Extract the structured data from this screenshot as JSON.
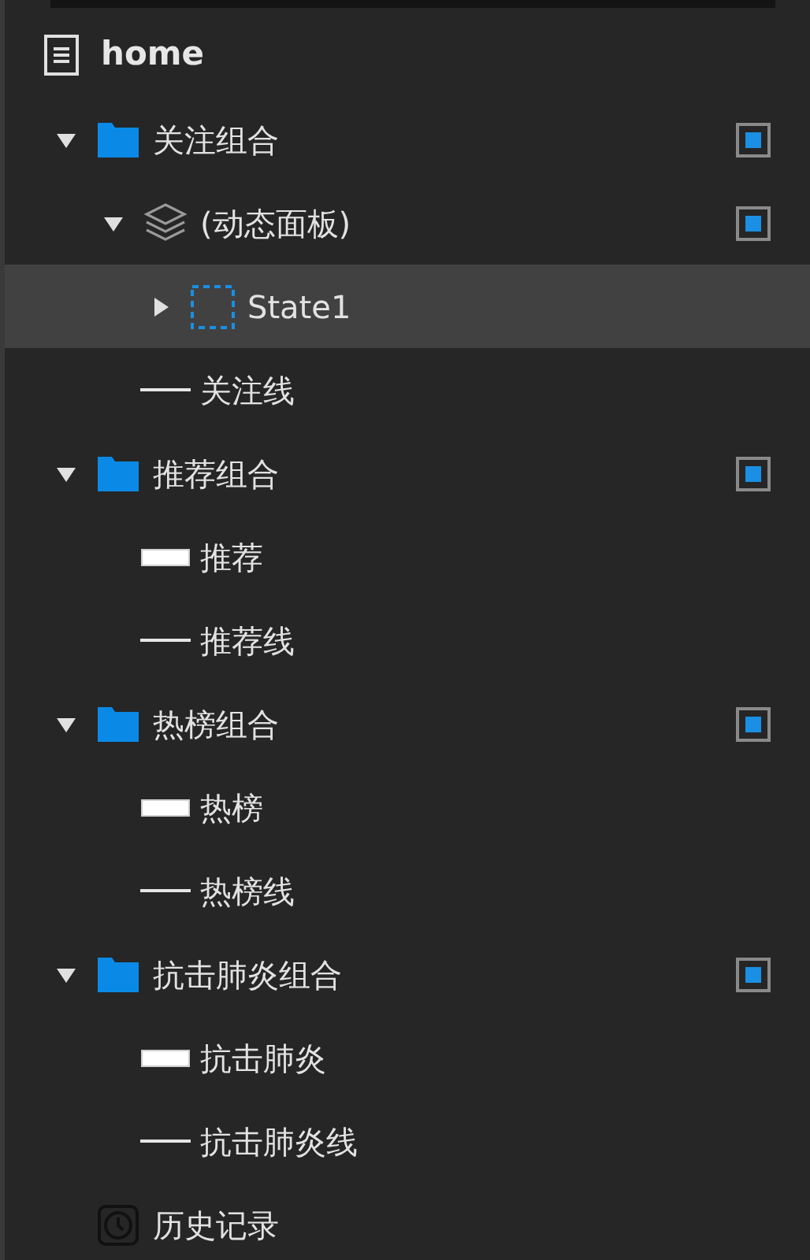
{
  "page": {
    "title": "home"
  },
  "layers": [
    {
      "kind": "group",
      "label": "关注组合",
      "expanded": true,
      "selected": false,
      "marked": true,
      "children": [
        {
          "kind": "panel",
          "label": "(动态面板)",
          "expanded": true,
          "selected": false,
          "marked": true,
          "children": [
            {
              "kind": "state",
              "label": "State1",
              "expanded": false,
              "selected": true
            }
          ]
        },
        {
          "kind": "line",
          "label": "关注线",
          "selected": false
        }
      ]
    },
    {
      "kind": "group",
      "label": "推荐组合",
      "expanded": true,
      "selected": false,
      "marked": true,
      "children": [
        {
          "kind": "rect",
          "label": "推荐",
          "selected": false
        },
        {
          "kind": "line",
          "label": "推荐线",
          "selected": false
        }
      ]
    },
    {
      "kind": "group",
      "label": "热榜组合",
      "expanded": true,
      "selected": false,
      "marked": true,
      "children": [
        {
          "kind": "rect",
          "label": "热榜",
          "selected": false
        },
        {
          "kind": "line",
          "label": "热榜线",
          "selected": false
        }
      ]
    },
    {
      "kind": "group",
      "label": "抗击肺炎组合",
      "expanded": true,
      "selected": false,
      "marked": true,
      "children": [
        {
          "kind": "rect",
          "label": "抗击肺炎",
          "selected": false
        },
        {
          "kind": "line",
          "label": "抗击肺炎线",
          "selected": false
        }
      ]
    },
    {
      "kind": "history",
      "label": "历史记录",
      "selected": false
    }
  ]
}
